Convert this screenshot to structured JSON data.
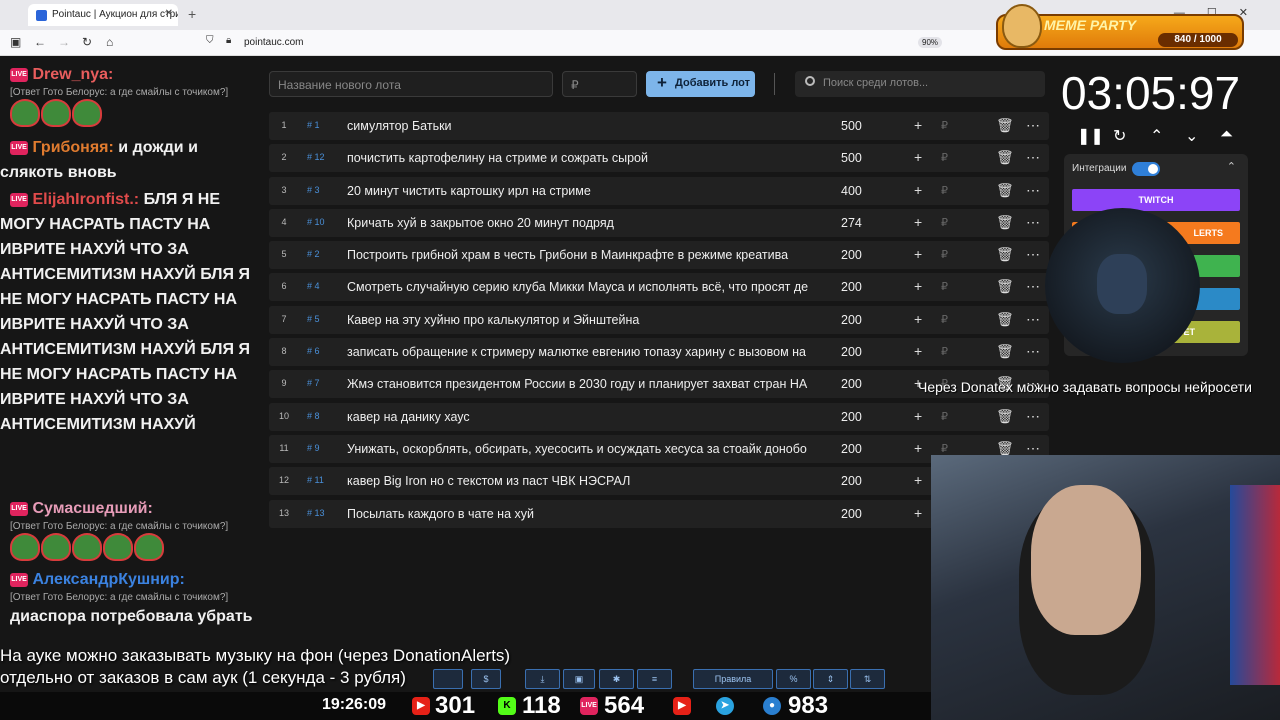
{
  "browser": {
    "tab_title": "Pointauc | Аукцион для стриме",
    "url": "pointauc.com",
    "zoom": "90%"
  },
  "overlay": {
    "meme_party_title": "MEME PARTY",
    "meme_party_score": "840 / 1000"
  },
  "chat": [
    {
      "user": "Drew_nya:",
      "color": "#e85d5d",
      "reply": "[Ответ Гото Белорус: а где смайлы с точиком?]",
      "text": "",
      "emotes": 3
    },
    {
      "user": "Грибоняя:",
      "color": "#e07b2f",
      "reply": "",
      "text": "и дожди и слякоть вновь",
      "emotes": 0
    },
    {
      "user": "ElijahIronfist.:",
      "color": "#e14b4b",
      "reply": "",
      "text": "БЛЯ Я НЕ МОГУ НАСРАТЬ ПАСТУ НА ИВРИТЕ НАХУЙ ЧТО ЗА АНТИСЕМИТИЗМ НАХУЙ БЛЯ Я НЕ МОГУ НАСРАТЬ ПАСТУ НА ИВРИТЕ НАХУЙ ЧТО ЗА АНТИСЕМИТИЗМ НАХУЙ БЛЯ Я НЕ МОГУ НАСРАТЬ ПАСТУ НА ИВРИТЕ НАХУЙ ЧТО ЗА АНТИСЕМИТИЗМ НАХУЙ",
      "emotes": 0
    },
    {
      "user": "Сумасшедший:",
      "color": "#e79cb8",
      "reply": "[Ответ Гото Белорус: а где смайлы с точиком?]",
      "text": "",
      "emotes": 5
    },
    {
      "user": "АлександрКушнир:",
      "color": "#3b82e0",
      "reply": "[Ответ Гото Белорус: а где смайлы с точиком?]",
      "text": "диаспора потребовала убрать",
      "emotes": 0
    }
  ],
  "controls": {
    "lot_placeholder": "Название нового лота",
    "price_placeholder": "₽",
    "add_button": "Добавить лот",
    "search_placeholder": "Поиск среди лотов..."
  },
  "lots": [
    {
      "n": "1",
      "id": "# 1",
      "name": "симулятор Батьки",
      "amount": "500"
    },
    {
      "n": "2",
      "id": "# 12",
      "name": "почистить картофелину на стриме и сожрать сырой",
      "amount": "500"
    },
    {
      "n": "3",
      "id": "# 3",
      "name": "20 минут чистить картошку ирл на стриме",
      "amount": "400"
    },
    {
      "n": "4",
      "id": "# 10",
      "name": "Кричать хуй в закрытое окно 20 минут подряд",
      "amount": "274"
    },
    {
      "n": "5",
      "id": "# 2",
      "name": "Построить грибной храм в честь Грибони в Маинкрафте в режиме креатива",
      "amount": "200"
    },
    {
      "n": "6",
      "id": "# 4",
      "name": "Смотреть случайную серию клуба Микки Мауса и исполнять всё, что просят де",
      "amount": "200"
    },
    {
      "n": "7",
      "id": "# 5",
      "name": "Кавер на эту хуйню про калькулятор и Эйнштейна",
      "amount": "200"
    },
    {
      "n": "8",
      "id": "# 6",
      "name": "записать обращение к стримеру малютке евгению топазу харину с вызовом на",
      "amount": "200"
    },
    {
      "n": "9",
      "id": "# 7",
      "name": " Жмэ становится президентом России в 2030 году и планирует захват стран НА",
      "amount": "200"
    },
    {
      "n": "10",
      "id": "# 8",
      "name": "кавер на данику хаус",
      "amount": "200"
    },
    {
      "n": "11",
      "id": "# 9",
      "name": "Унижать, оскорблять, обсирать, хуесосить и осуждать хесуса за стоайк донобо",
      "amount": "200"
    },
    {
      "n": "12",
      "id": "# 11",
      "name": "кавер Big Iron но с текстом из паст ЧВК НЭСРАЛ",
      "amount": "200"
    },
    {
      "n": "13",
      "id": "# 13",
      "name": "Посылать каждого в чате на хуй",
      "amount": "200"
    }
  ],
  "timer": {
    "value": "03:05:97"
  },
  "integrations": {
    "label": "Интеграции",
    "twitch": "TWITCH",
    "alerts": "LERTS",
    "other": "ET"
  },
  "donatex_text": "Через Donatex можно задавать вопросы нейросети",
  "bottom_text": {
    "line1": "На ауке можно заказывать музыку на фон (через DonationAlerts)",
    "line2": "отдельно от заказов в сам аук (1 секунда - 3 рубля)"
  },
  "toolbar": {
    "rules": "Правила",
    "percent": "%"
  },
  "status": {
    "clock": "19:26:09",
    "youtube": "301",
    "kick": "118",
    "live": "564",
    "telegram": "983"
  }
}
